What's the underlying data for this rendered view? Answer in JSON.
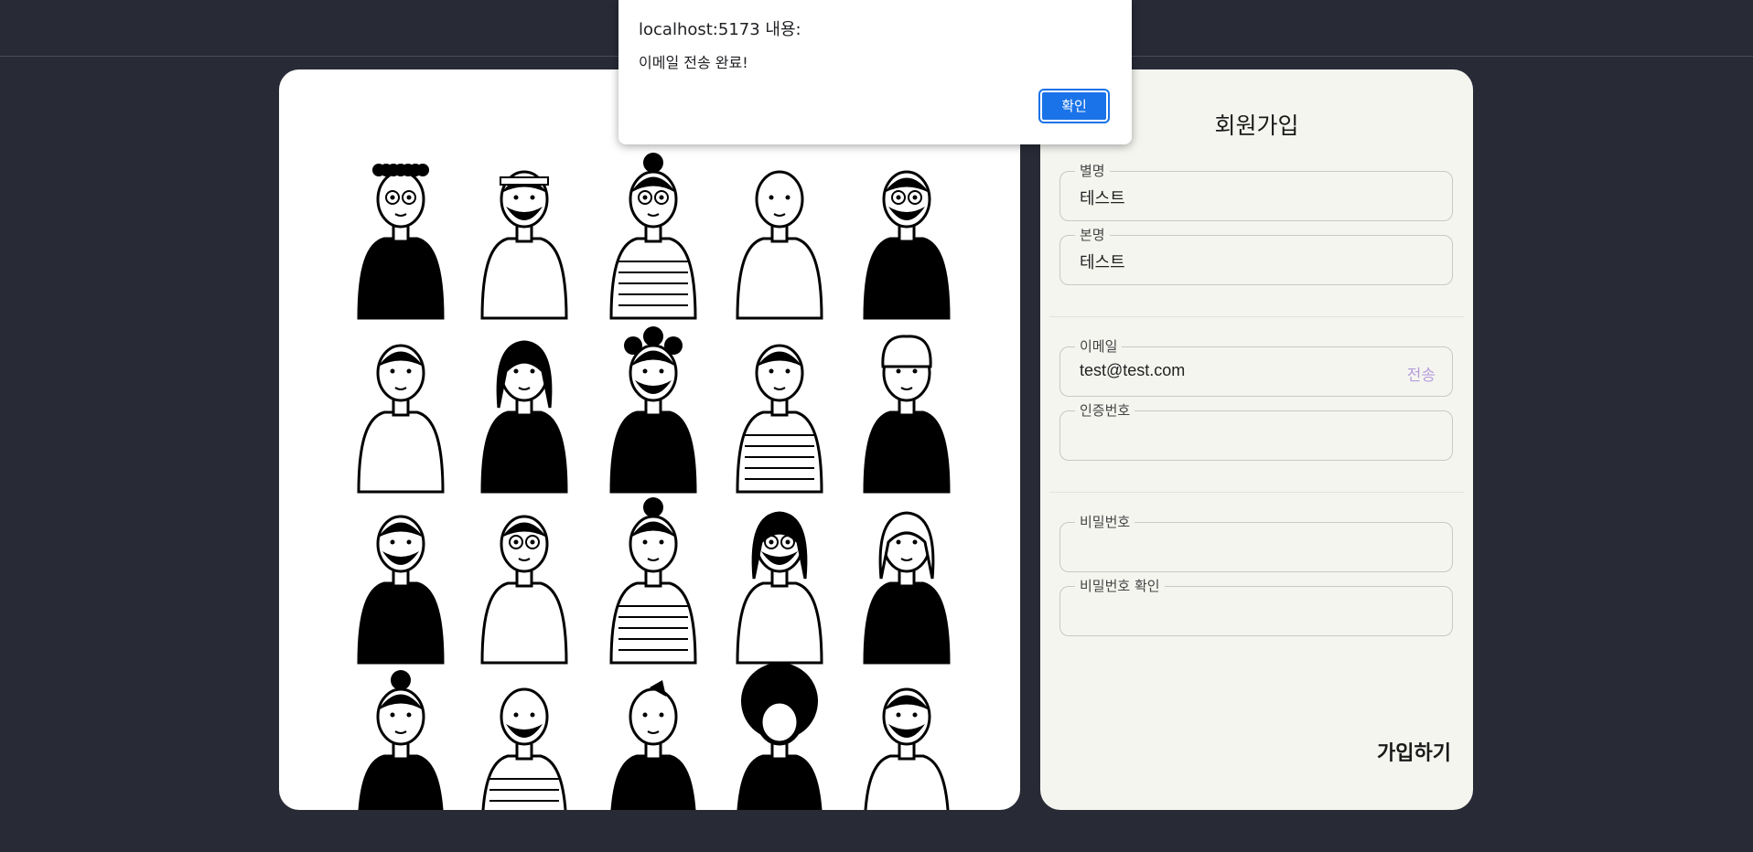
{
  "dialog": {
    "origin": "localhost:5173 내용:",
    "message": "이메일 전송 완료!",
    "ok_label": "확인"
  },
  "illustration": {
    "rows": 4,
    "columns": 5
  },
  "signup": {
    "title": "회원가입",
    "nickname": {
      "label": "별명",
      "value": "테스트"
    },
    "real_name": {
      "label": "본명",
      "value": "테스트"
    },
    "email": {
      "label": "이메일",
      "value": "test@test.com",
      "send_label": "전송"
    },
    "verification_code": {
      "label": "인증번호",
      "value": ""
    },
    "password": {
      "label": "비밀번호",
      "value": ""
    },
    "password_confirm": {
      "label": "비밀번호 확인",
      "value": ""
    },
    "submit_label": "가입하기"
  },
  "colors": {
    "background": "#282a36",
    "card": "#ffffff",
    "form_card": "#f5f5f0",
    "send_text": "#b69fdc",
    "dialog_button": "#1a73e8"
  }
}
